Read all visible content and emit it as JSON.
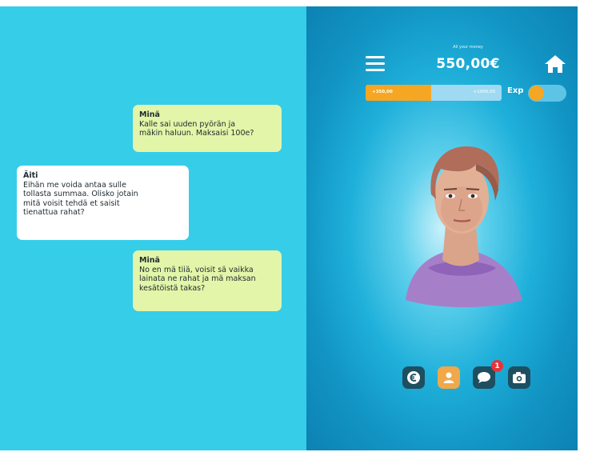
{
  "chat": {
    "messages": [
      {
        "sender": "Minä",
        "text": "Kalle sai uuden pyörän ja\nmäkin haluun. Maksaisi 100e?"
      },
      {
        "sender": "Äiti",
        "text": "Eihän me voida antaa sulle\ntollasta summaa. Olisko jotain\nmitä voisit tehdä et saisit\ntienattua rahat?"
      },
      {
        "sender": "Minä",
        "text": "No en mä tiiä, voisit sä vaikka\nlainata ne rahat ja mä maksan\nkesätöistä takas?"
      }
    ]
  },
  "header": {
    "money_caption": "All your money",
    "money_value": "550,00€"
  },
  "progress": {
    "left_label": "+350,00",
    "right_label": "+1000,00",
    "fill_fraction": 0.48
  },
  "exp": {
    "label": "Exp",
    "toggle_on": false
  },
  "bottom_nav": {
    "items": [
      {
        "icon": "euro-icon"
      },
      {
        "icon": "profile-icon"
      },
      {
        "icon": "chat-icon"
      },
      {
        "icon": "camera-icon"
      }
    ],
    "chat_badge": "1"
  },
  "colors": {
    "chat_background": "#36cde9",
    "my_bubble": "#e3f5a8",
    "other_bubble": "#ffffff",
    "accent": "#f5a623",
    "nav_dark": "#1d4f60",
    "badge": "#e4353a"
  }
}
